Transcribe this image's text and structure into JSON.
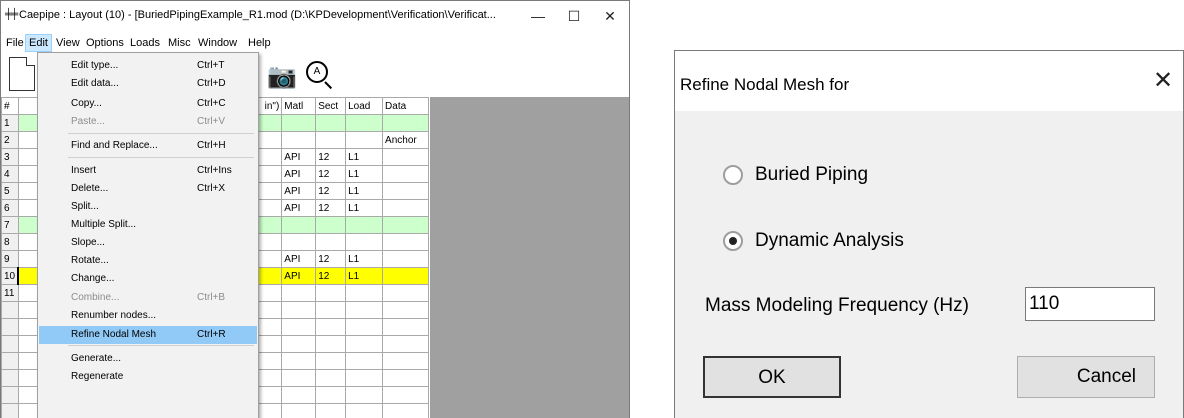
{
  "window": {
    "title": "Caepipe : Layout (10) - [BuriedPipingExample_R1.mod (D:\\KPDevelopment\\Verification\\Verificat...",
    "app_icon": "caepipe-icon",
    "controls": [
      "—",
      "☐",
      "✕"
    ]
  },
  "menubar": [
    "File",
    "Edit",
    "View",
    "Options",
    "Loads",
    "Misc",
    "Window",
    "Help"
  ],
  "edit_menu": {
    "items": [
      {
        "label": "Edit type...",
        "shortcut": "Ctrl+T",
        "disabled": false
      },
      {
        "label": "Edit data...",
        "shortcut": "Ctrl+D",
        "disabled": false
      },
      {
        "label": "Copy...",
        "shortcut": "Ctrl+C",
        "disabled": false
      },
      {
        "label": "Paste...",
        "shortcut": "Ctrl+V",
        "disabled": true
      },
      {
        "label": "Find and Replace...",
        "shortcut": "Ctrl+H",
        "disabled": false
      },
      {
        "label": "Insert",
        "shortcut": "Ctrl+Ins",
        "disabled": false
      },
      {
        "label": "Delete...",
        "shortcut": "Ctrl+X",
        "disabled": false
      },
      {
        "label": "Split...",
        "shortcut": "",
        "disabled": false
      },
      {
        "label": "Multiple Split...",
        "shortcut": "",
        "disabled": false
      },
      {
        "label": "Slope...",
        "shortcut": "",
        "disabled": false
      },
      {
        "label": "Rotate...",
        "shortcut": "",
        "disabled": false
      },
      {
        "label": "Change...",
        "shortcut": "",
        "disabled": false
      },
      {
        "label": "Combine...",
        "shortcut": "Ctrl+B",
        "disabled": true
      },
      {
        "label": "Renumber nodes...",
        "shortcut": "",
        "disabled": false
      },
      {
        "label": "Refine Nodal Mesh",
        "shortcut": "Ctrl+R",
        "disabled": false,
        "highlighted": true
      },
      {
        "label": "Generate...",
        "shortcut": "",
        "disabled": false
      },
      {
        "label": "Regenerate",
        "shortcut": "",
        "disabled": false
      }
    ]
  },
  "grid": {
    "headers": [
      "#",
      "",
      "in\")",
      "Matl",
      "Sect",
      "Load",
      "Data"
    ],
    "rows": [
      {
        "n": "1",
        "matl": "",
        "sect": "",
        "load": "",
        "data": "",
        "style": "green"
      },
      {
        "n": "2",
        "matl": "",
        "sect": "",
        "load": "",
        "data": "Anchor",
        "style": ""
      },
      {
        "n": "3",
        "matl": "API",
        "sect": "12",
        "load": "L1",
        "data": "",
        "style": ""
      },
      {
        "n": "4",
        "matl": "API",
        "sect": "12",
        "load": "L1",
        "data": "",
        "style": ""
      },
      {
        "n": "5",
        "matl": "API",
        "sect": "12",
        "load": "L1",
        "data": "",
        "style": ""
      },
      {
        "n": "6",
        "matl": "API",
        "sect": "12",
        "load": "L1",
        "data": "",
        "style": ""
      },
      {
        "n": "7",
        "matl": "",
        "sect": "",
        "load": "",
        "data": "",
        "style": "green"
      },
      {
        "n": "8",
        "matl": "",
        "sect": "",
        "load": "",
        "data": "",
        "style": ""
      },
      {
        "n": "9",
        "matl": "API",
        "sect": "12",
        "load": "L1",
        "data": "",
        "style": ""
      },
      {
        "n": "10",
        "matl": "API",
        "sect": "12",
        "load": "L1",
        "data": "",
        "style": "yellow"
      },
      {
        "n": "11",
        "matl": "",
        "sect": "",
        "load": "",
        "data": "",
        "style": ""
      },
      {
        "n": "",
        "matl": "",
        "sect": "",
        "load": "",
        "data": "",
        "style": ""
      },
      {
        "n": "",
        "matl": "",
        "sect": "",
        "load": "",
        "data": "",
        "style": ""
      },
      {
        "n": "",
        "matl": "",
        "sect": "",
        "load": "",
        "data": "",
        "style": ""
      },
      {
        "n": "",
        "matl": "",
        "sect": "",
        "load": "",
        "data": "",
        "style": ""
      },
      {
        "n": "",
        "matl": "",
        "sect": "",
        "load": "",
        "data": "",
        "style": ""
      },
      {
        "n": "",
        "matl": "",
        "sect": "",
        "load": "",
        "data": "",
        "style": ""
      },
      {
        "n": "",
        "matl": "",
        "sect": "",
        "load": "",
        "data": "",
        "style": ""
      }
    ]
  },
  "dialog": {
    "title": "Refine Nodal Mesh for",
    "close": "✕",
    "option_buried": "Buried Piping",
    "option_dynamic": "Dynamic Analysis",
    "selected": "dynamic",
    "freq_label": "Mass Modeling Frequency (Hz)",
    "freq_value": "110",
    "ok": "OK",
    "cancel": "Cancel"
  },
  "colors": {
    "highlight": "#91c9f7",
    "green_row": "#ccffcc",
    "yellow_row": "#ffff00",
    "mdi_background": "#a0a0a0"
  }
}
